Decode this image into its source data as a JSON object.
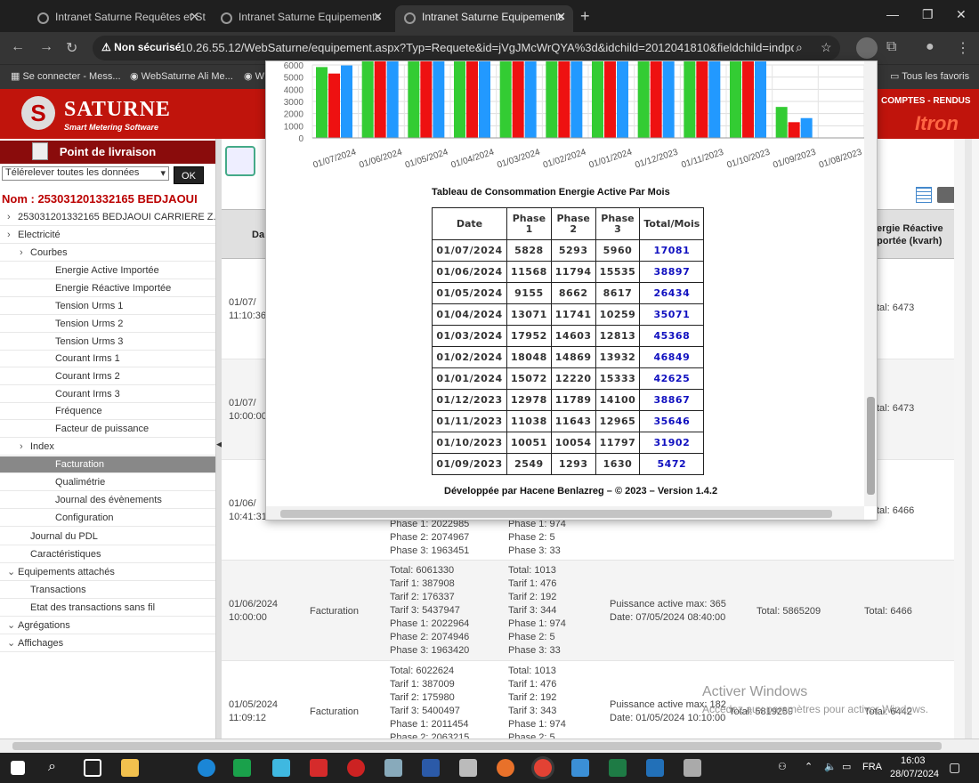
{
  "browser": {
    "tabs": [
      {
        "title": "Intranet Saturne Requêtes et St",
        "active": false
      },
      {
        "title": "Intranet Saturne Equipements",
        "active": false
      },
      {
        "title": "Intranet Saturne Equipements",
        "active": true
      }
    ],
    "security_label": "Non sécurisé",
    "url": "10.26.55.12/WebSaturne/equipement.aspx?Typ=Requete&id=jVgJMcWrQYA%3d&idchild=2012041810&fieldchild=indpdl.ind_i...",
    "bookmarks": [
      "Se connecter - Mess...",
      "WebSaturne Ali Me...",
      "W"
    ],
    "all_bookmarks": "Tous les favoris"
  },
  "banner": {
    "logo_title": "SATURNE",
    "logo_subtitle": "Smart Metering Software",
    "right_text": "COMPTES - RENDUS",
    "right_logo": "Itron"
  },
  "sidebar": {
    "header": "Point de livraison",
    "select_value": "Télérelever toutes les données",
    "ok_label": "OK",
    "nom_label": "Nom : 253031201332165 BEDJAOUI",
    "items": [
      {
        "label": "253031201332165 BEDJAOUI CARRIERE Z.IND",
        "arrow": "›"
      },
      {
        "label": "Electricité",
        "arrow": "›"
      },
      {
        "label": "Courbes",
        "arrow": "›"
      },
      {
        "label": "Energie Active Importée",
        "arrow": ""
      },
      {
        "label": "Energie Réactive Importée",
        "arrow": ""
      },
      {
        "label": "Tension Urms 1",
        "arrow": ""
      },
      {
        "label": "Tension Urms 2",
        "arrow": ""
      },
      {
        "label": "Tension Urms 3",
        "arrow": ""
      },
      {
        "label": "Courant Irms 1",
        "arrow": ""
      },
      {
        "label": "Courant Irms 2",
        "arrow": ""
      },
      {
        "label": "Courant Irms 3",
        "arrow": ""
      },
      {
        "label": "Fréquence",
        "arrow": ""
      },
      {
        "label": "Facteur de puissance",
        "arrow": ""
      },
      {
        "label": "Index",
        "arrow": "›"
      },
      {
        "label": "Facturation",
        "arrow": ""
      },
      {
        "label": "Qualimétrie",
        "arrow": ""
      },
      {
        "label": "Journal des évènements",
        "arrow": ""
      },
      {
        "label": "Configuration",
        "arrow": ""
      },
      {
        "label": "Journal du PDL",
        "arrow": ""
      },
      {
        "label": "Caractéristiques",
        "arrow": ""
      },
      {
        "label": "Equipements attachés",
        "arrow": "⌄"
      },
      {
        "label": "Transactions",
        "arrow": ""
      },
      {
        "label": "Etat des transactions sans fil",
        "arrow": ""
      },
      {
        "label": "Agrégations",
        "arrow": "⌄"
      },
      {
        "label": "Affichages",
        "arrow": "⌄"
      }
    ]
  },
  "main": {
    "col_date": "Da",
    "col_reactive": "ergie Réactive\nportée (kvarh)",
    "rows": [
      {
        "date": "01/07/\n11:10:36",
        "reactive": "tal: 6473"
      },
      {
        "date": "01/07/\n10:00:00",
        "reactive": "tal: 6473"
      },
      {
        "date": "01/06/\n10:41:31",
        "reactive": "tal: 6466",
        "col1": "Phase 1: 2022985\nPhase 2: 2074967\nPhase 3: 1963451",
        "col2": "Phase 1: 974\nPhase 2: 5\nPhase 3: 33"
      },
      {
        "date": "01/06/2024\n10:00:00",
        "type": "Facturation",
        "col1": "Total: 6061330\nTarif 1: 387908\nTarif 2: 176337\nTarif 3: 5437947\nPhase 1: 2022964\nPhase 2: 2074946\nPhase 3: 1963420",
        "col2": "Total: 1013\nTarif 1: 476\nTarif 2: 192\nTarif 3: 344\nPhase 1: 974\nPhase 2: 5\nPhase 3: 33",
        "puissance": "Puissance active max: 365\nDate: 07/05/2024 08:40:00",
        "total": "Total: 5865209",
        "reactive": "Total: 6466"
      },
      {
        "date": "01/05/2024\n11:09:12",
        "type": "Facturation",
        "col1": "Total: 6022624\nTarif 1: 387009\nTarif 2: 175980\nTarif 3: 5400497\nPhase 1: 2011454\nPhase 2: 2063215",
        "col2": "Total: 1013\nTarif 1: 476\nTarif 2: 192\nTarif 3: 343\nPhase 1: 974\nPhase 2: 5",
        "puissance": "Puissance active max: 182\nDate: 01/05/2024 10:10:00",
        "total": "Total: 5819259",
        "reactive": "Total: 6442"
      }
    ]
  },
  "modal": {
    "table_title": "Tableau de Consommation Energie Active Par Mois",
    "headers": [
      "Date",
      "Phase\n1",
      "Phase\n2",
      "Phase\n3",
      "Total/Mois"
    ],
    "footer": "Développée par Hacene Benlazreg – © 2023 – Version 1.4.2"
  },
  "chart_data": {
    "type": "bar",
    "title": "",
    "ylabel": "",
    "ytick_labels": [
      "6000",
      "5000",
      "4000",
      "3000",
      "2000",
      "1000",
      "0"
    ],
    "categories": [
      "01/07/2024",
      "01/06/2024",
      "01/05/2024",
      "01/04/2024",
      "01/03/2024",
      "01/02/2024",
      "01/01/2024",
      "01/12/2023",
      "01/11/2023",
      "01/10/2023",
      "01/09/2023",
      "01/08/2023"
    ],
    "series": [
      {
        "color": "#33cc33",
        "values": [
          5828,
          11568,
          9155,
          13071,
          17952,
          18048,
          15072,
          12978,
          11038,
          10051,
          2549,
          0
        ]
      },
      {
        "color": "#ee1111",
        "values": [
          5293,
          11794,
          8662,
          11741,
          14603,
          14869,
          12220,
          11789,
          11643,
          10054,
          1293,
          0
        ]
      },
      {
        "color": "#2299ff",
        "values": [
          5960,
          15535,
          8617,
          10259,
          12813,
          13932,
          15333,
          14100,
          12965,
          11797,
          1630,
          0
        ]
      }
    ],
    "ylim": [
      0,
      6000
    ],
    "grid": true
  },
  "consumption_table": [
    {
      "date": "01/07/2024",
      "p1": "5828",
      "p2": "5293",
      "p3": "5960",
      "total": "17081"
    },
    {
      "date": "01/06/2024",
      "p1": "11568",
      "p2": "11794",
      "p3": "15535",
      "total": "38897"
    },
    {
      "date": "01/05/2024",
      "p1": "9155",
      "p2": "8662",
      "p3": "8617",
      "total": "26434"
    },
    {
      "date": "01/04/2024",
      "p1": "13071",
      "p2": "11741",
      "p3": "10259",
      "total": "35071"
    },
    {
      "date": "01/03/2024",
      "p1": "17952",
      "p2": "14603",
      "p3": "12813",
      "total": "45368"
    },
    {
      "date": "01/02/2024",
      "p1": "18048",
      "p2": "14869",
      "p3": "13932",
      "total": "46849"
    },
    {
      "date": "01/01/2024",
      "p1": "15072",
      "p2": "12220",
      "p3": "15333",
      "total": "42625"
    },
    {
      "date": "01/12/2023",
      "p1": "12978",
      "p2": "11789",
      "p3": "14100",
      "total": "38867"
    },
    {
      "date": "01/11/2023",
      "p1": "11038",
      "p2": "11643",
      "p3": "12965",
      "total": "35646"
    },
    {
      "date": "01/10/2023",
      "p1": "10051",
      "p2": "10054",
      "p3": "11797",
      "total": "31902"
    },
    {
      "date": "01/09/2023",
      "p1": "2549",
      "p2": "1293",
      "p3": "1630",
      "total": "5472"
    }
  ],
  "watermark": {
    "line1": "Activer Windows",
    "line2": "Accédez aux paramètres pour activer Windows."
  },
  "taskbar": {
    "lang": "FRA",
    "time": "16:03",
    "date": "28/07/2024"
  }
}
